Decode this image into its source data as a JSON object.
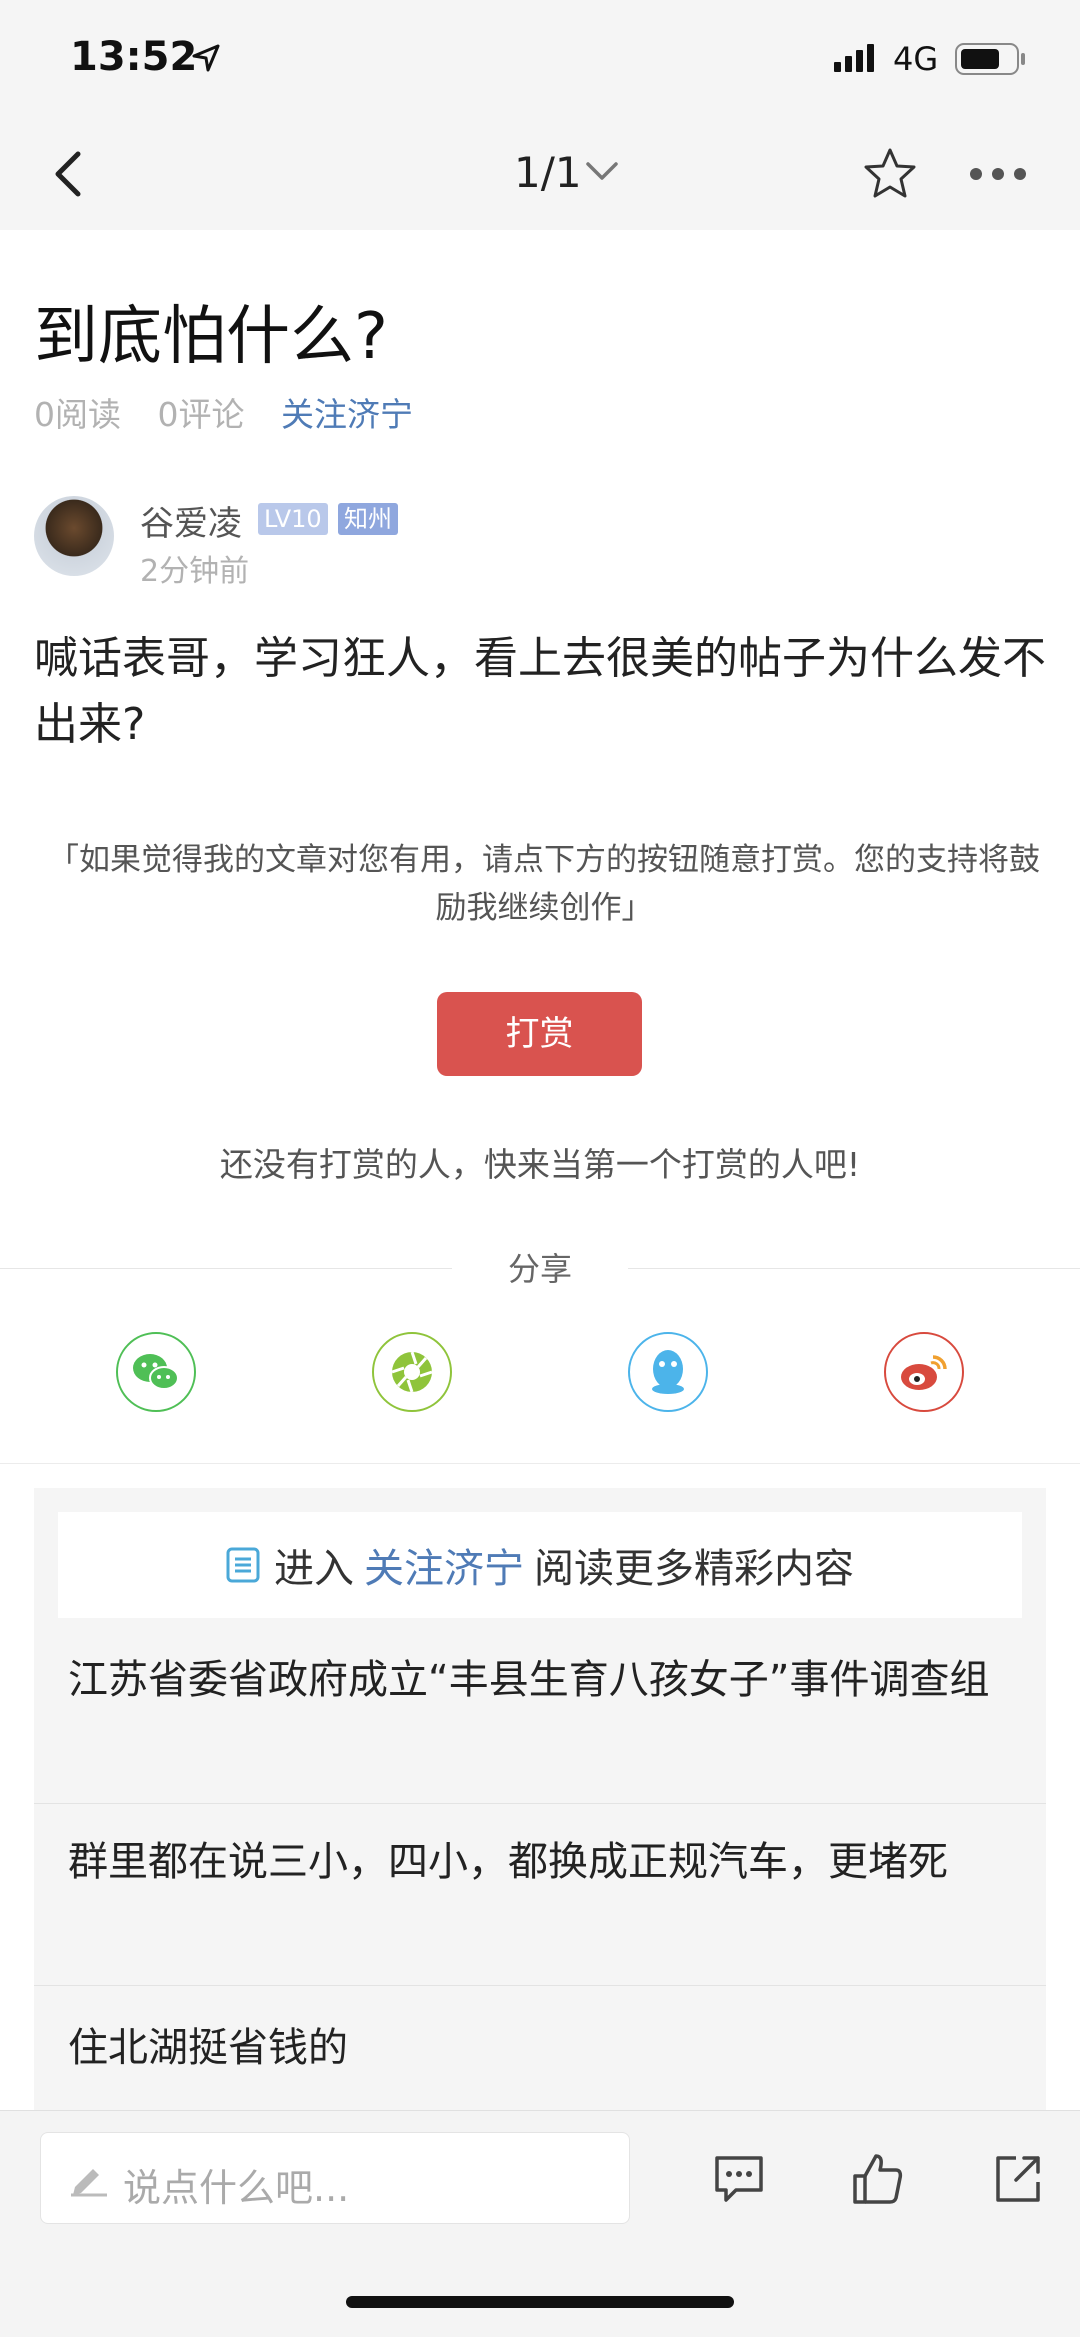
{
  "status_bar": {
    "time": "13:52",
    "network": "4G"
  },
  "nav": {
    "page_indicator": "1/1"
  },
  "post": {
    "title": "到底怕什么?",
    "reads": "0阅读",
    "comments": "0评论",
    "forum": "关注济宁",
    "author": "谷爱凌",
    "level_badge": "LV10",
    "rank_badge": "知州",
    "time": "2分钟前",
    "body": "喊话表哥，学习狂人，看上去很美的帖子为什么发不出来?"
  },
  "reward": {
    "note": "「如果觉得我的文章对您有用，请点下方的按钮随意打赏。您的支持将鼓励我继续创作」",
    "button": "打赏",
    "empty_text": "还没有打赏的人，快来当第一个打赏的人吧!"
  },
  "share": {
    "title": "分享",
    "targets": [
      {
        "icon": "wechat-icon",
        "color": "#4fbf56"
      },
      {
        "icon": "moments-icon",
        "color": "#8fc43b"
      },
      {
        "icon": "qq-icon",
        "color": "#4cb4ea"
      },
      {
        "icon": "weibo-icon",
        "color": "#d84a3e"
      }
    ]
  },
  "more": {
    "prefix": "进入",
    "forum_link": "关注济宁",
    "suffix": "阅读更多精彩内容",
    "items": [
      "江苏省委省政府成立“丰县生育八孩女子”事件调查组",
      "群里都在说三小，四小，都换成正规汽车，更堵死",
      "住北湖挺省钱的"
    ]
  },
  "bottom_bar": {
    "comment_placeholder": "说点什么吧..."
  }
}
